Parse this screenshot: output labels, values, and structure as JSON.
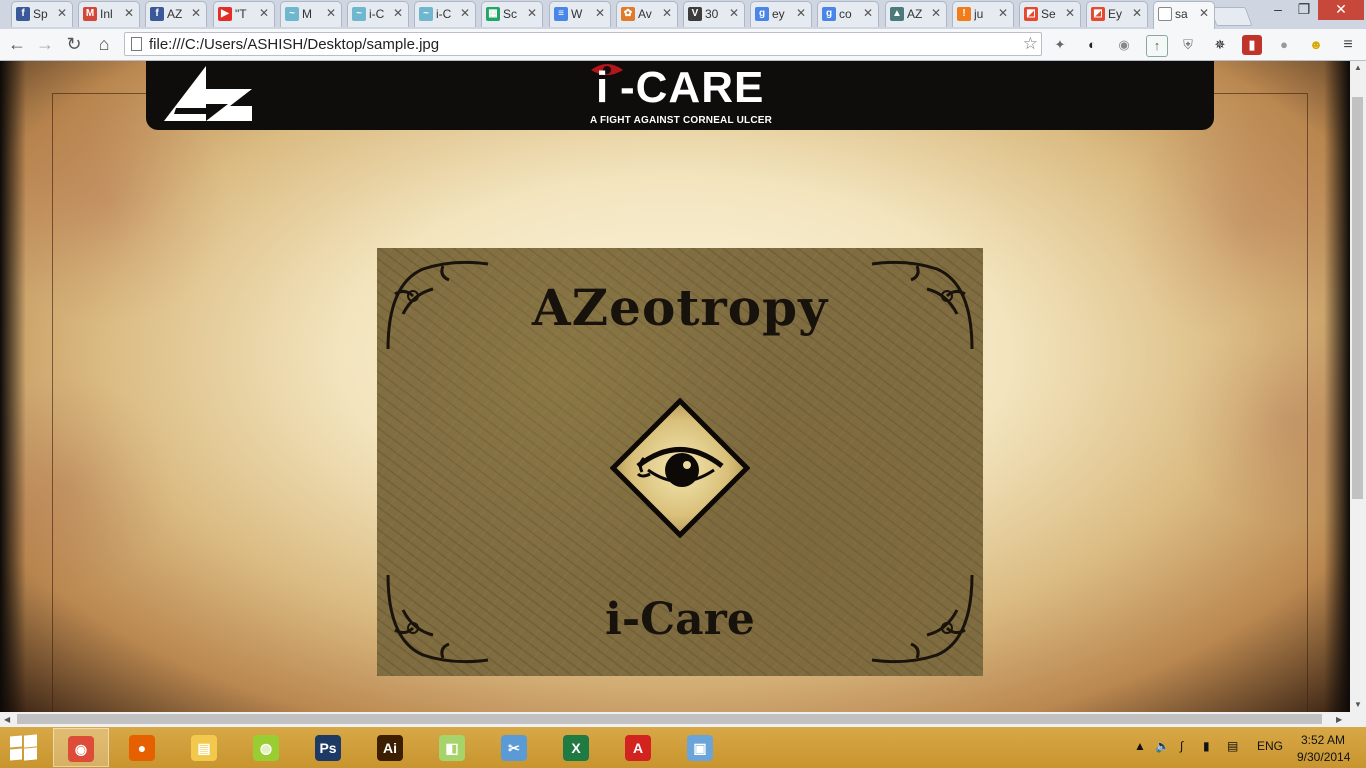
{
  "browser": {
    "tabs": [
      {
        "label": "Sp",
        "icon": "facebook-icon",
        "color": "#3b5998",
        "glyph": "f"
      },
      {
        "label": "Inl",
        "icon": "gmail-icon",
        "color": "#d44638",
        "glyph": "M"
      },
      {
        "label": "AZ",
        "icon": "facebook-icon",
        "color": "#3b5998",
        "glyph": "f"
      },
      {
        "label": "\"T",
        "icon": "youtube-icon",
        "color": "#e52d27",
        "glyph": "▶"
      },
      {
        "label": "M",
        "icon": "bird-icon",
        "color": "#6fb7cf",
        "glyph": "~"
      },
      {
        "label": "i-C",
        "icon": "bird-icon",
        "color": "#6fb7cf",
        "glyph": "~"
      },
      {
        "label": "i-C",
        "icon": "bird-icon",
        "color": "#6fb7cf",
        "glyph": "~"
      },
      {
        "label": "Sc",
        "icon": "sheets-icon",
        "color": "#23a566",
        "glyph": "▦"
      },
      {
        "label": "W",
        "icon": "docs-icon",
        "color": "#4a86e8",
        "glyph": "≡"
      },
      {
        "label": "Av",
        "icon": "gear-icon",
        "color": "#e07b2c",
        "glyph": "✿"
      },
      {
        "label": "30",
        "icon": "v-icon",
        "color": "#3c3c3c",
        "glyph": "V"
      },
      {
        "label": "ey",
        "icon": "google-icon",
        "color": "#4a86e8",
        "glyph": "g"
      },
      {
        "label": "co",
        "icon": "google-icon",
        "color": "#4a86e8",
        "glyph": "g"
      },
      {
        "label": "AZ",
        "icon": "az-icon",
        "color": "#4c7a7a",
        "glyph": "▲"
      },
      {
        "label": "ju",
        "icon": "orange-circle-icon",
        "color": "#f07c1a",
        "glyph": "!"
      },
      {
        "label": "Se",
        "icon": "slides-icon",
        "color": "#e34a2f",
        "glyph": "◩"
      },
      {
        "label": "Ey",
        "icon": "slides-icon",
        "color": "#e34a2f",
        "glyph": "◩"
      },
      {
        "label": "sa",
        "icon": "page-icon",
        "color": "#ffffff",
        "glyph": ""
      }
    ],
    "url": "file:///C:/Users/ASHISH/Desktop/sample.jpg",
    "window_controls": [
      "–",
      "❐",
      "✕"
    ]
  },
  "page": {
    "banner_title": "i-CARE",
    "banner_title_i": "i",
    "banner_title_rest": "-CARE",
    "banner_tagline": "A FIGHT AGAINST CORNEAL ULCER",
    "poster_heading": "AZeotropy",
    "poster_sub": "i-Care"
  },
  "taskbar": {
    "apps": [
      {
        "name": "chrome",
        "glyph": "◉",
        "color": "#dd4b39"
      },
      {
        "name": "firefox",
        "glyph": "●",
        "color": "#e66000"
      },
      {
        "name": "file-explorer",
        "glyph": "▤",
        "color": "#f2c94c"
      },
      {
        "name": "media-app",
        "glyph": "◍",
        "color": "#9acd32"
      },
      {
        "name": "photoshop",
        "glyph": "Ps",
        "color": "#1c3a63"
      },
      {
        "name": "illustrator",
        "glyph": "Ai",
        "color": "#3b1f00"
      },
      {
        "name": "sticky-notes",
        "glyph": "◧",
        "color": "#a6d46b"
      },
      {
        "name": "snipping-tool",
        "glyph": "✂",
        "color": "#5b9bd5"
      },
      {
        "name": "excel",
        "glyph": "X",
        "color": "#1f7a43"
      },
      {
        "name": "acrobat",
        "glyph": "A",
        "color": "#d2231f"
      },
      {
        "name": "photo-viewer",
        "glyph": "▣",
        "color": "#6aa4d9"
      }
    ],
    "language": "ENG",
    "time": "3:52 AM",
    "date": "9/30/2014"
  }
}
